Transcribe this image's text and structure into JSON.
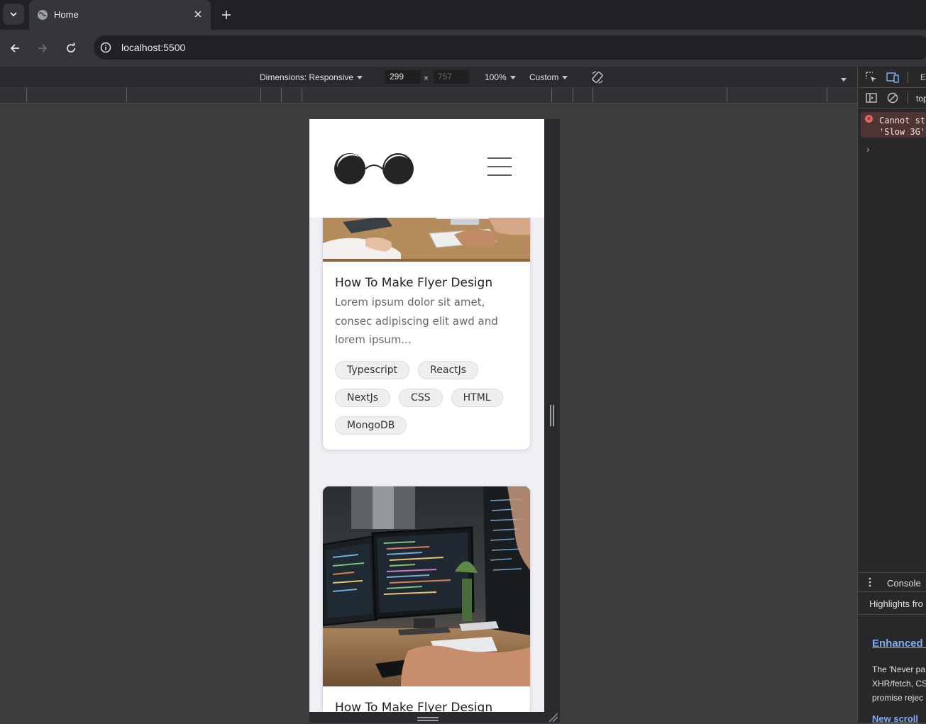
{
  "browser": {
    "tab_title": "Home",
    "url": "localhost:5500"
  },
  "device_toolbar": {
    "dimensions_label": "Dimensions: Responsive",
    "width": "299",
    "height": "757",
    "separator": "×",
    "zoom": "100%",
    "throttle": "Custom"
  },
  "site": {
    "cards": [
      {
        "title": "How To Make Flyer Design",
        "description": "Lorem ipsum dolor sit amet, consec adipiscing elit awd and lorem ipsum...",
        "tags": [
          "Typescript",
          "ReactJs",
          "NextJs",
          "CSS",
          "HTML",
          "MongoDB"
        ]
      },
      {
        "title": "How To Make Flyer Design"
      }
    ]
  },
  "devtools": {
    "tab_partial": "El",
    "context_partial": "top",
    "error_text": "Cannot st\n'Slow 3G'",
    "prompt": "›",
    "drawer_title": "Console",
    "highlights_text": "Highlights fro",
    "whats_new_heading": "Enhanced '",
    "whats_new_body": "The 'Never pa\nXHR/fetch, CS\npromise rejec",
    "whats_new_heading2": "New scroll"
  },
  "colors": {
    "browser_bg": "#202124",
    "toolbar_bg": "#35363a",
    "viewport_bg": "#3c3c3c",
    "page_bg": "#f0eff5",
    "link_blue": "#7cacf8",
    "error_bg": "#4e3534"
  }
}
